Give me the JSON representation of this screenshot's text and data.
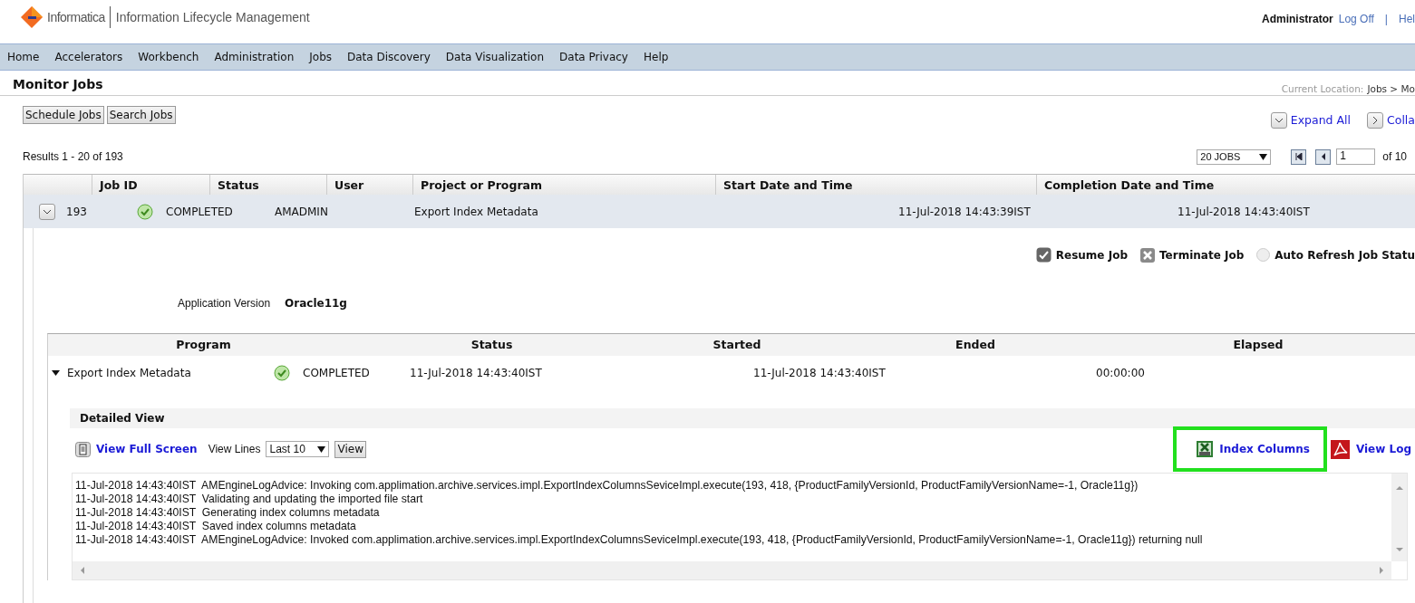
{
  "header": {
    "brand": "Informatica",
    "product": "Information Lifecycle Management",
    "user": "Administrator",
    "logoff": "Log Off",
    "separator": "|",
    "help": "Hel"
  },
  "nav": [
    "Home",
    "Accelerators",
    "Workbench",
    "Administration",
    "Jobs",
    "Data Discovery",
    "Data Visualization",
    "Data Privacy",
    "Help"
  ],
  "page": {
    "title": "Monitor Jobs",
    "location_label": "Current Location:",
    "location_path": "Jobs > Mo"
  },
  "toolbar": {
    "buttons": [
      "Schedule Jobs",
      "Search Jobs"
    ],
    "expand_all": "Expand All",
    "collapse_all": "Colla"
  },
  "results": {
    "summary": "Results 1 - 20 of 193",
    "page_size": "20 JOBS",
    "page": "1",
    "of_pages": "of 10"
  },
  "jobs_table": {
    "columns": [
      "Job ID",
      "Status",
      "User",
      "Project or Program",
      "Start Date and Time",
      "Completion Date and Time"
    ],
    "rows": [
      {
        "expanded": true,
        "job_id": "193",
        "status": "COMPLETED",
        "user": "AMADMIN",
        "project": "Export Index Metadata",
        "start": "11-Jul-2018 14:43:39IST",
        "completion": "11-Jul-2018 14:43:40IST"
      }
    ]
  },
  "job_actions": {
    "resume": "Resume Job",
    "terminate": "Terminate Job",
    "auto_refresh": {
      "label": "Auto Refresh Job Statu",
      "checked": false
    }
  },
  "application_version": {
    "label": "Application Version",
    "value": "Oracle11g"
  },
  "program_table": {
    "columns": [
      "Program",
      "Status",
      "Started",
      "Ended",
      "Elapsed"
    ],
    "rows": [
      {
        "expanded": true,
        "program": "Export Index Metadata",
        "status": "COMPLETED",
        "started": "11-Jul-2018 14:43:40IST",
        "ended": "11-Jul-2018 14:43:40IST",
        "elapsed": "00:00:00"
      }
    ]
  },
  "detailed_view": {
    "title": "Detailed View",
    "full_screen": "View Full Screen",
    "view_lines_label": "View Lines",
    "view_lines_value": "Last 10",
    "view_button": "View",
    "links": [
      {
        "kind": "csv",
        "label": "Index Columns",
        "highlighted": true
      },
      {
        "kind": "pdf",
        "label": "View Log",
        "highlighted": false
      }
    ],
    "log_lines": [
      "11-Jul-2018 14:43:40IST  AMEngineLogAdvice: Invoking com.applimation.archive.services.impl.ExportIndexColumnsSeviceImpl.execute(193, 418, {ProductFamilyVersionId, ProductFamilyVersionName=-1, Oracle11g})",
      "11-Jul-2018 14:43:40IST  Validating and updating the imported file start",
      "11-Jul-2018 14:43:40IST  Generating index columns metadata",
      "11-Jul-2018 14:43:40IST  Saved index columns metadata",
      "11-Jul-2018 14:43:40IST  AMEngineLogAdvice: Invoked com.applimation.archive.services.impl.ExportIndexColumnsSeviceImpl.execute(193, 418, {ProductFamilyVersionId, ProductFamilyVersionName=-1, Oracle11g}) returning null"
    ]
  }
}
